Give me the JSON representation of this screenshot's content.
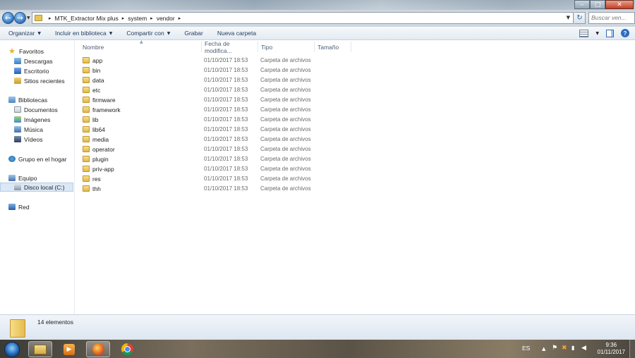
{
  "window": {
    "controls": {
      "minimize": "‒",
      "maximize": "□",
      "close": "✕"
    }
  },
  "navigation": {
    "back_icon": "arrow-left-icon",
    "forward_icon": "arrow-right-icon",
    "breadcrumbs": [
      "MTK_Extractor Mix plus",
      "system",
      "vendor"
    ],
    "search_placeholder": "Buscar ven..."
  },
  "toolbar": {
    "organize_label": "Organizar",
    "include_library_label": "Incluir en biblioteca",
    "share_label": "Compartir con",
    "burn_label": "Grabar",
    "new_folder_label": "Nueva carpeta"
  },
  "sidebar": {
    "favorites": {
      "label": "Favoritos",
      "items": [
        "Descargas",
        "Escritorio",
        "Sitios recientes"
      ]
    },
    "libraries": {
      "label": "Bibliotecas",
      "items": [
        "Documentos",
        "Imágenes",
        "Música",
        "Vídeos"
      ]
    },
    "homegroup": "Grupo en el hogar",
    "computer": {
      "label": "Equipo",
      "items": [
        "Disco local (C:)"
      ]
    },
    "network": "Red"
  },
  "columns": {
    "name": "Nombre",
    "date": "Fecha de modifica...",
    "type": "Tipo",
    "size": "Tamaño"
  },
  "files": [
    {
      "name": "app",
      "date": "01/10/2017 18:53",
      "type": "Carpeta de archivos"
    },
    {
      "name": "bin",
      "date": "01/10/2017 18:53",
      "type": "Carpeta de archivos"
    },
    {
      "name": "data",
      "date": "01/10/2017 18:53",
      "type": "Carpeta de archivos"
    },
    {
      "name": "etc",
      "date": "01/10/2017 18:53",
      "type": "Carpeta de archivos"
    },
    {
      "name": "firmware",
      "date": "01/10/2017 18:53",
      "type": "Carpeta de archivos"
    },
    {
      "name": "framework",
      "date": "01/10/2017 18:53",
      "type": "Carpeta de archivos"
    },
    {
      "name": "lib",
      "date": "01/10/2017 18:53",
      "type": "Carpeta de archivos"
    },
    {
      "name": "lib64",
      "date": "01/10/2017 18:53",
      "type": "Carpeta de archivos"
    },
    {
      "name": "media",
      "date": "01/10/2017 18:53",
      "type": "Carpeta de archivos"
    },
    {
      "name": "operator",
      "date": "01/10/2017 18:53",
      "type": "Carpeta de archivos"
    },
    {
      "name": "plugin",
      "date": "01/10/2017 18:53",
      "type": "Carpeta de archivos"
    },
    {
      "name": "priv-app",
      "date": "01/10/2017 18:53",
      "type": "Carpeta de archivos"
    },
    {
      "name": "res",
      "date": "01/10/2017 18:53",
      "type": "Carpeta de archivos"
    },
    {
      "name": "thh",
      "date": "01/10/2017 18:53",
      "type": "Carpeta de archivos"
    }
  ],
  "status": {
    "count_text": "14 elementos"
  },
  "taskbar": {
    "pinned": [
      "explorer-icon",
      "media-player-icon",
      "firefox-icon",
      "chrome-icon"
    ],
    "language": "ES",
    "time": "9:36",
    "date": "01/11/2017"
  }
}
